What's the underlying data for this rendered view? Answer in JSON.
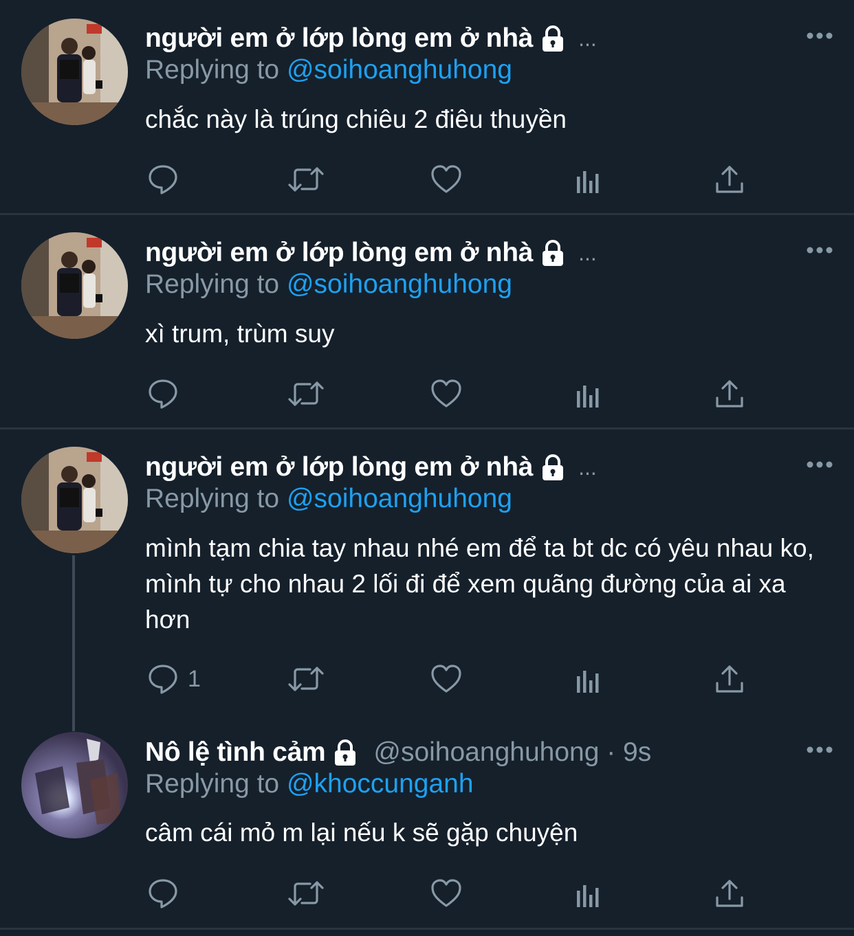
{
  "tweets": [
    {
      "display_name": "người em ở lớp lòng em ở nhà",
      "ellipsis": "...",
      "replying_prefix": "Replying to ",
      "replying_handle": "@soihoanghuhong",
      "text": "chắc này là trúng chiêu 2 điêu thuyền",
      "reply_count": ""
    },
    {
      "display_name": "người em ở lớp lòng em ở nhà",
      "ellipsis": "...",
      "replying_prefix": "Replying to ",
      "replying_handle": "@soihoanghuhong",
      "text": "xì trum, trùm suy",
      "reply_count": ""
    },
    {
      "display_name": "người em ở lớp lòng em ở nhà",
      "ellipsis": "...",
      "replying_prefix": "Replying to ",
      "replying_handle": "@soihoanghuhong",
      "text": "mình tạm chia tay nhau nhé em để ta bt dc có yêu nhau ko, mình tự cho nhau 2 lối đi để xem quãng đường của ai xa hơn",
      "reply_count": "1"
    },
    {
      "display_name": "Nô lệ tình cảm",
      "handle_time": "@soihoanghuhong · 9s",
      "replying_prefix": "Replying to ",
      "replying_handle": "@khoccunganh",
      "text": "câm cái mỏ m lại nếu k sẽ gặp chuyện",
      "reply_count": ""
    }
  ],
  "colors": {
    "background": "#15202b",
    "secondary_text": "#8899a6",
    "accent_link": "#1da1f2",
    "divider": "#2a343f"
  },
  "icons": [
    "lock-icon",
    "more-icon",
    "reply-icon",
    "retweet-icon",
    "like-icon",
    "analytics-icon",
    "share-icon"
  ]
}
